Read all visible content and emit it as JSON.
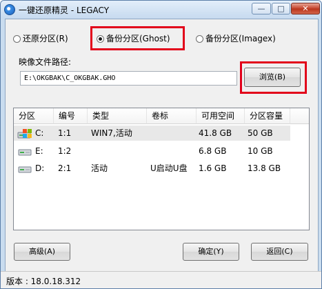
{
  "window": {
    "title": "一键还原精灵 - LEGACY",
    "min_glyph": "—",
    "max_glyph": "□",
    "close_glyph": "✕"
  },
  "options": [
    {
      "label": "还原分区(R)",
      "checked": false
    },
    {
      "label": "备份分区(Ghost)",
      "checked": true
    },
    {
      "label": "备份分区(Imagex)",
      "checked": false
    }
  ],
  "image_path": {
    "label": "映像文件路径:",
    "value": "E:\\OKGBAK\\C_OKGBAK.GHO"
  },
  "browse_label": "浏览(B)",
  "table": {
    "columns": [
      "分区",
      "编号",
      "类型",
      "卷标",
      "可用空间",
      "分区容量"
    ],
    "rows": [
      {
        "drive": "C:",
        "number": "1:1",
        "type": "WIN7,活动",
        "label": "",
        "free": "41.8 GB",
        "size": "50 GB",
        "icon": "system-drive-icon"
      },
      {
        "drive": "E:",
        "number": "1:2",
        "type": "",
        "label": "",
        "free": "6.8 GB",
        "size": "10 GB",
        "icon": "hard-drive-icon"
      },
      {
        "drive": "D:",
        "number": "2:1",
        "type": "活动",
        "label": "U启动U盘",
        "free": "1.6 GB",
        "size": "13.8 GB",
        "icon": "hard-drive-icon"
      }
    ]
  },
  "buttons": {
    "advanced": "高级(A)",
    "ok": "确定(Y)",
    "back": "返回(C)"
  },
  "status": {
    "version": "版本 : 18.0.18.312"
  },
  "colors": {
    "highlight": "#e2001a",
    "selected_row": "#e8e8e8"
  }
}
